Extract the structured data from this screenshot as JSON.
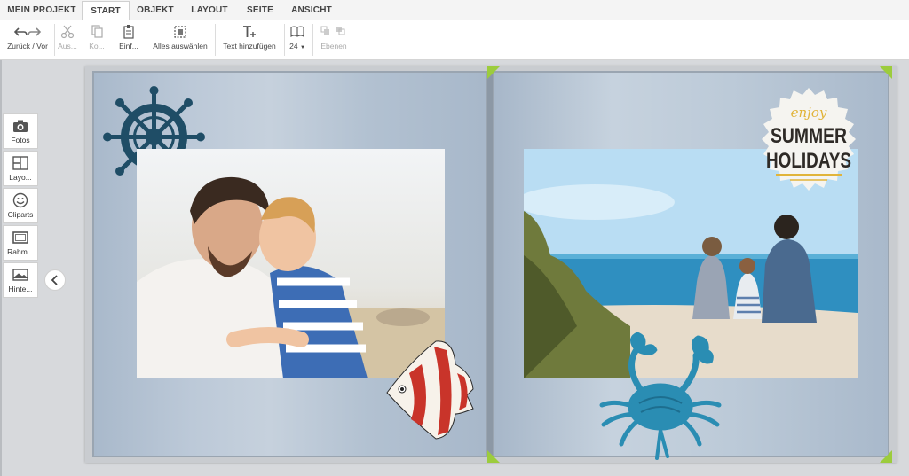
{
  "tabs": [
    {
      "label": "MEIN PROJEKT",
      "active": false
    },
    {
      "label": "START",
      "active": true
    },
    {
      "label": "OBJEKT",
      "active": false
    },
    {
      "label": "LAYOUT",
      "active": false
    },
    {
      "label": "SEITE",
      "active": false
    },
    {
      "label": "ANSICHT",
      "active": false
    }
  ],
  "toolbar": {
    "undo_redo": "Zurück / Vor",
    "cut": "Aus...",
    "copy": "Ko...",
    "paste": "Einf...",
    "select_all": "Alles auswählen",
    "add_text": "Text hinzufügen",
    "font_size": "24",
    "layers": "Ebenen"
  },
  "palette": {
    "photos": "Fotos",
    "layouts": "Layo...",
    "cliparts": "Cliparts",
    "frames": "Rahm...",
    "backgrounds": "Hinte..."
  },
  "sticker": {
    "line1": "enjoy",
    "line2": "SUMMER",
    "line3": "HOLIDAYS"
  },
  "colors": {
    "accent_green": "#9ccc3d",
    "navy_clipart": "#1f4d66",
    "crab_blue": "#2a8db3",
    "fish_red": "#c9342a"
  }
}
